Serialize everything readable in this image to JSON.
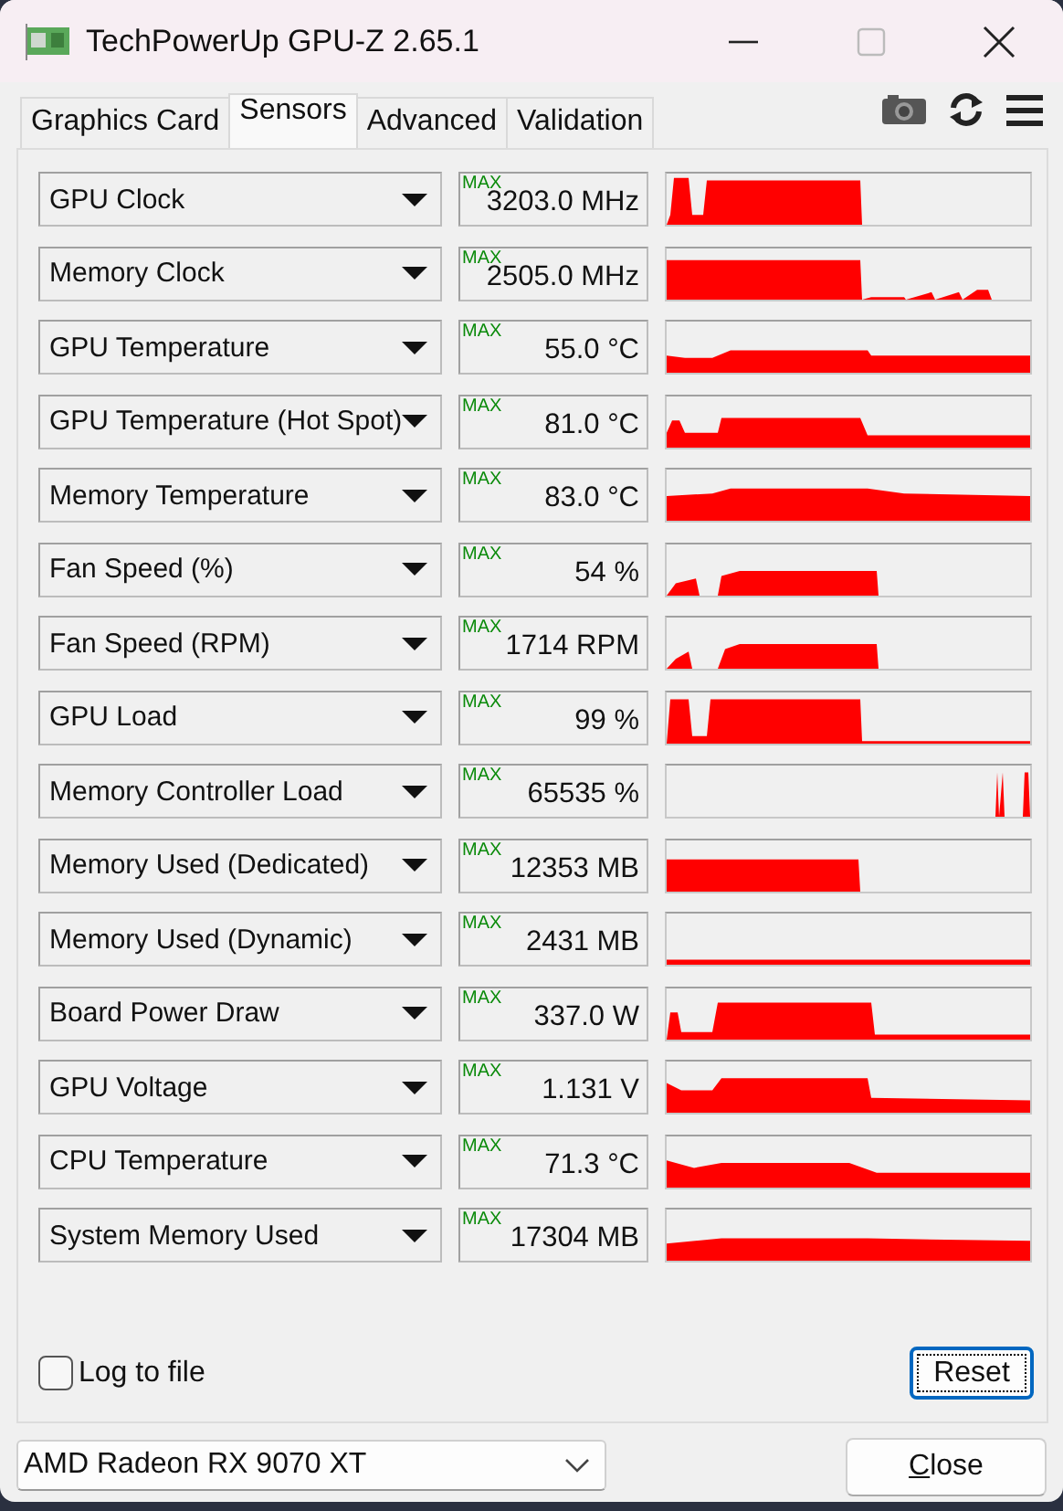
{
  "window": {
    "title": "TechPowerUp GPU-Z 2.65.1"
  },
  "tabs": [
    {
      "label": "Graphics Card",
      "selected": false
    },
    {
      "label": "Sensors",
      "selected": true
    },
    {
      "label": "Advanced",
      "selected": false
    },
    {
      "label": "Validation",
      "selected": false
    }
  ],
  "sensors": [
    {
      "name": "GPU Clock",
      "max_label": "MAX",
      "value": "3203.0 MHz"
    },
    {
      "name": "Memory Clock",
      "max_label": "MAX",
      "value": "2505.0 MHz"
    },
    {
      "name": "GPU Temperature",
      "max_label": "MAX",
      "value": "55.0 °C"
    },
    {
      "name": "GPU Temperature (Hot Spot)",
      "max_label": "MAX",
      "value": "81.0 °C"
    },
    {
      "name": "Memory Temperature",
      "max_label": "MAX",
      "value": "83.0 °C"
    },
    {
      "name": "Fan Speed (%)",
      "max_label": "MAX",
      "value": "54 %"
    },
    {
      "name": "Fan Speed (RPM)",
      "max_label": "MAX",
      "value": "1714 RPM"
    },
    {
      "name": "GPU Load",
      "max_label": "MAX",
      "value": "99 %"
    },
    {
      "name": "Memory Controller Load",
      "max_label": "MAX",
      "value": "65535 %"
    },
    {
      "name": "Memory Used (Dedicated)",
      "max_label": "MAX",
      "value": "12353 MB"
    },
    {
      "name": "Memory Used (Dynamic)",
      "max_label": "MAX",
      "value": "2431 MB"
    },
    {
      "name": "Board Power Draw",
      "max_label": "MAX",
      "value": "337.0 W"
    },
    {
      "name": "GPU Voltage",
      "max_label": "MAX",
      "value": "1.131 V"
    },
    {
      "name": "CPU Temperature",
      "max_label": "MAX",
      "value": "71.3 °C"
    },
    {
      "name": "System Memory Used",
      "max_label": "MAX",
      "value": "17304 MB"
    }
  ],
  "log_to_file": {
    "label": "Log to file",
    "checked": false
  },
  "reset_button": {
    "label": "Reset"
  },
  "gpu_select": {
    "value": "AMD Radeon RX 9070 XT"
  },
  "close_button": {
    "label": "Close"
  }
}
